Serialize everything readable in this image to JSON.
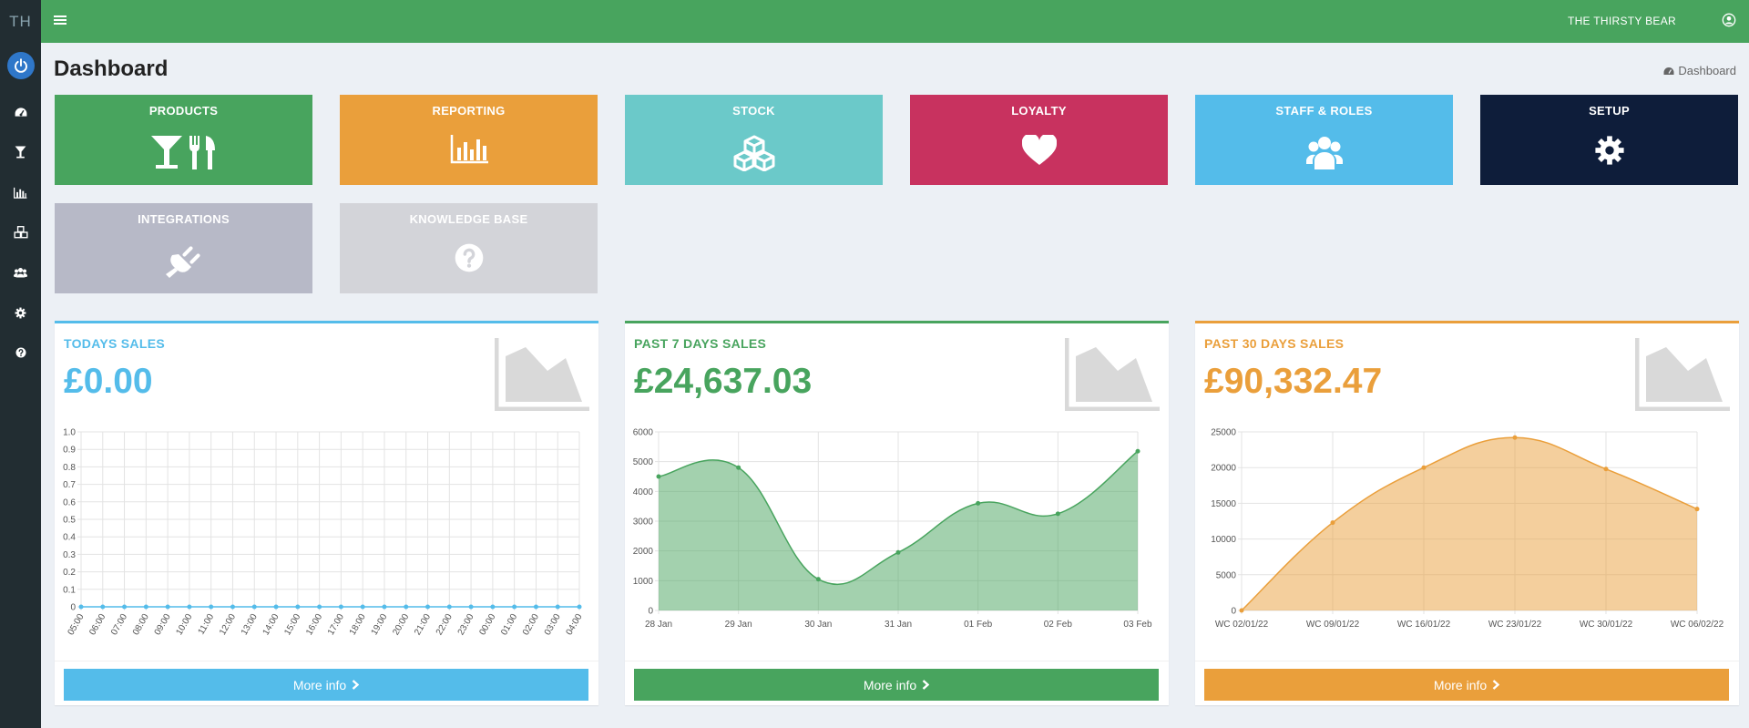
{
  "app": {
    "brand": "TH",
    "account_name": "THE THIRSTY BEAR"
  },
  "page": {
    "title": "Dashboard",
    "breadcrumb": "Dashboard"
  },
  "sidebar": {
    "items": [
      {
        "icon": "dashboard-icon"
      },
      {
        "icon": "cocktail-icon"
      },
      {
        "icon": "bar-chart-icon"
      },
      {
        "icon": "cubes-icon"
      },
      {
        "icon": "users-icon"
      },
      {
        "icon": "gear-icon"
      },
      {
        "icon": "question-icon"
      }
    ]
  },
  "tiles": [
    {
      "label": "PRODUCTS",
      "icon": "cocktail-cutlery-icon",
      "color": "#48a45e"
    },
    {
      "label": "REPORTING",
      "icon": "bar-chart-icon",
      "color": "#ea9f3b"
    },
    {
      "label": "STOCK",
      "icon": "cubes-icon",
      "color": "#6bc9c9"
    },
    {
      "label": "LOYALTY",
      "icon": "heart-icon",
      "color": "#c8325f"
    },
    {
      "label": "STAFF & ROLES",
      "icon": "users-icon",
      "color": "#54bcea"
    },
    {
      "label": "SETUP",
      "icon": "gear-icon",
      "color": "#0e1d3a"
    },
    {
      "label": "INTEGRATIONS",
      "icon": "plug-icon",
      "color": "#b7b9c7"
    },
    {
      "label": "KNOWLEDGE BASE",
      "icon": "question-icon",
      "color": "#d3d4d9"
    }
  ],
  "boxes": [
    {
      "title": "TODAYS SALES",
      "amount": "£0.00",
      "color": "#54bcea",
      "more_label": "More info"
    },
    {
      "title": "PAST 7 DAYS SALES",
      "amount": "£24,637.03",
      "color": "#48a45e",
      "more_label": "More info"
    },
    {
      "title": "PAST 30 DAYS SALES",
      "amount": "£90,332.47",
      "color": "#ea9f3b",
      "more_label": "More info"
    }
  ],
  "chart_data": [
    {
      "type": "line",
      "x": [
        "05:00",
        "06:00",
        "07:00",
        "08:00",
        "09:00",
        "10:00",
        "11:00",
        "12:00",
        "13:00",
        "14:00",
        "15:00",
        "16:00",
        "17:00",
        "18:00",
        "19:00",
        "20:00",
        "21:00",
        "22:00",
        "23:00",
        "00:00",
        "01:00",
        "02:00",
        "03:00",
        "04:00"
      ],
      "values": [
        0,
        0,
        0,
        0,
        0,
        0,
        0,
        0,
        0,
        0,
        0,
        0,
        0,
        0,
        0,
        0,
        0,
        0,
        0,
        0,
        0,
        0,
        0,
        0
      ],
      "ylim": [
        0,
        1
      ],
      "yticks": [
        "0",
        "0.1",
        "0.2",
        "0.3",
        "0.4",
        "0.5",
        "0.6",
        "0.7",
        "0.8",
        "0.9",
        "1.0"
      ],
      "grid": true,
      "color": "#54bcea"
    },
    {
      "type": "area",
      "x": [
        "28 Jan",
        "29 Jan",
        "30 Jan",
        "31 Jan",
        "01 Feb",
        "02 Feb",
        "03 Feb"
      ],
      "values": [
        4500,
        4800,
        1050,
        1950,
        3600,
        3250,
        5350
      ],
      "ylim": [
        0,
        6000
      ],
      "yticks": [
        "0",
        "1000",
        "2000",
        "3000",
        "4000",
        "5000",
        "6000"
      ],
      "grid": true,
      "color": "#48a45e"
    },
    {
      "type": "area",
      "x": [
        "WC 02/01/22",
        "WC 09/01/22",
        "WC 16/01/22",
        "WC 23/01/22",
        "WC 30/01/22",
        "WC 06/02/22"
      ],
      "values": [
        0,
        12300,
        20000,
        24200,
        19800,
        14200
      ],
      "ylim": [
        0,
        25000
      ],
      "yticks": [
        "0",
        "5000",
        "10000",
        "15000",
        "20000",
        "25000"
      ],
      "grid": true,
      "color": "#ea9f3b"
    }
  ]
}
